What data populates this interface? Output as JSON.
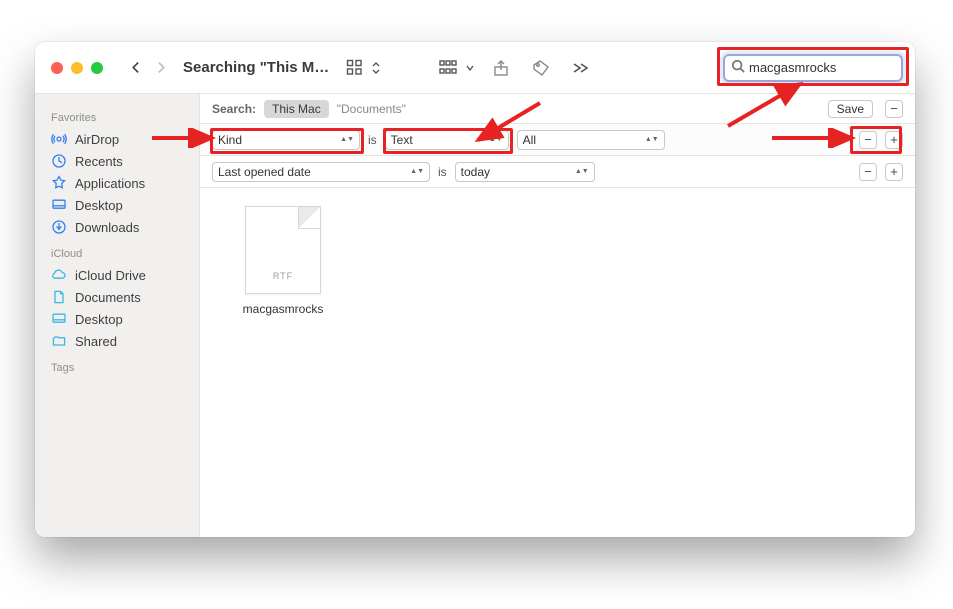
{
  "window": {
    "title": "Searching \"This M…"
  },
  "search": {
    "value": "macgasmrocks"
  },
  "scope": {
    "label": "Search:",
    "selected": "This Mac",
    "alt": "\"Documents\"",
    "save": "Save"
  },
  "criteria": [
    {
      "attr": "Kind",
      "op": "is",
      "value": "Text",
      "extra": "All"
    },
    {
      "attr": "Last opened date",
      "op": "is",
      "value": "today"
    }
  ],
  "sidebar": {
    "sections": [
      {
        "title": "Favorites",
        "items": [
          {
            "label": "AirDrop",
            "icon": "airdrop"
          },
          {
            "label": "Recents",
            "icon": "clock"
          },
          {
            "label": "Applications",
            "icon": "apps"
          },
          {
            "label": "Desktop",
            "icon": "desktop"
          },
          {
            "label": "Downloads",
            "icon": "download"
          }
        ]
      },
      {
        "title": "iCloud",
        "items": [
          {
            "label": "iCloud Drive",
            "icon": "cloud"
          },
          {
            "label": "Documents",
            "icon": "doc"
          },
          {
            "label": "Desktop",
            "icon": "desktop"
          },
          {
            "label": "Shared",
            "icon": "folder"
          }
        ]
      },
      {
        "title": "Tags",
        "items": []
      }
    ]
  },
  "file": {
    "name": "macgasmrocks",
    "ext": "RTF"
  },
  "glyphs": {
    "minus": "−",
    "plus": "+"
  }
}
